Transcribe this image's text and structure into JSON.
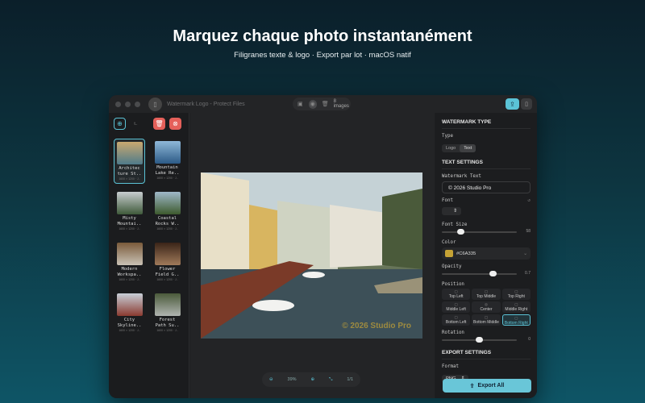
{
  "hero": {
    "title": "Marquez chaque photo instantanément",
    "subtitle": "Filigranes texte & logo · Export par lot · macOS natif"
  },
  "window": {
    "title": "Watermark Logo - Protect Files",
    "image_count": "8 images"
  },
  "sidebar": {
    "back_label": "t..",
    "items": [
      {
        "name": "Architec\nture St..",
        "size": "1600 × 1200 · J..",
        "colors": [
          "#c9a870",
          "#4f7b8a"
        ],
        "selected": true
      },
      {
        "name": "Mountain\nLake Re..",
        "size": "1600 × 1200 · J..",
        "colors": [
          "#8fb8d8",
          "#2c5a86"
        ]
      },
      {
        "name": "Misty\nMountai..",
        "size": "1600 × 1200 · J..",
        "colors": [
          "#c8cdd0",
          "#3f5a3a"
        ]
      },
      {
        "name": "Coastal\nRocks W..",
        "size": "1600 × 1200 · J..",
        "colors": [
          "#9fb8c9",
          "#3d5a2d"
        ]
      },
      {
        "name": "Modern\nWorkspa..",
        "size": "1600 × 1200 · J..",
        "colors": [
          "#7a5a3a",
          "#c9c2b5"
        ]
      },
      {
        "name": "Flower\nField G..",
        "size": "1600 × 1200 · J..",
        "colors": [
          "#3a2418",
          "#a07a5a"
        ]
      },
      {
        "name": "City\nSkyline..",
        "size": "1600 × 1200 · J..",
        "colors": [
          "#c8d0d8",
          "#8a3a30"
        ]
      },
      {
        "name": "Forest\nPath Su..",
        "size": "1600 × 1200 · J..",
        "colors": [
          "#4a5a3a",
          "#b0b4b0"
        ]
      }
    ]
  },
  "canvas": {
    "watermark_text": "© 2026 Studio Pro",
    "zoom": "39%",
    "page": "1/1"
  },
  "panel": {
    "watermark_type_header": "WATERMARK TYPE",
    "type_label": "Type",
    "type_options": [
      "Logo",
      "Text"
    ],
    "text_settings_header": "TEXT SETTINGS",
    "watermark_text_label": "Watermark Text",
    "watermark_text": "© 2026 Studio Pro",
    "font_label": "Font",
    "font_value": "",
    "font_size_label": "Font Size",
    "font_size": 58,
    "color_label": "Color",
    "color_value": "#C6A335",
    "opacity_label": "Opacity",
    "opacity": "0.7",
    "position_label": "Position",
    "positions": [
      "Top Left",
      "Top Middle",
      "Top Right",
      "Middle Left",
      "Center",
      "Middle Right",
      "Bottom Left",
      "Bottom Middle",
      "Bottom Right"
    ],
    "selected_position": "Bottom Right",
    "rotation_label": "Rotation",
    "rotation": "0",
    "export_settings_header": "EXPORT SETTINGS",
    "format_label": "Format",
    "format_value": "PNG",
    "export_button": "Export All"
  },
  "colors": {
    "accent": "#5BC3D6",
    "danger": "#E5605A",
    "watermark": "#C6A335"
  }
}
